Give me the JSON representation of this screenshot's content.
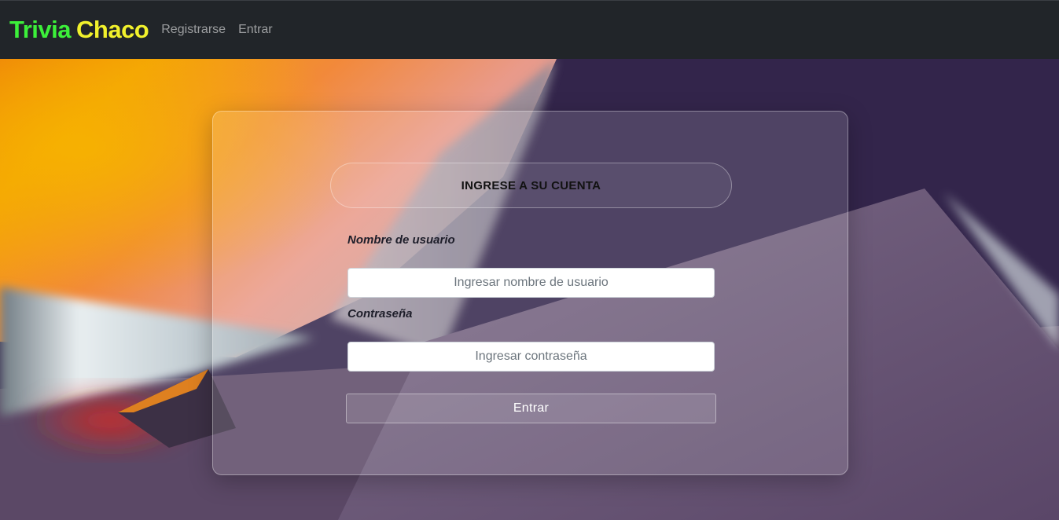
{
  "navbar": {
    "brand": {
      "part1": "Trivia",
      "part2": "Chaco",
      "part1_color": "#3cf03a",
      "part2_color": "#f1f12c"
    },
    "links": [
      {
        "label": "Registrarse"
      },
      {
        "label": "Entrar"
      }
    ],
    "background_color": "#212529"
  },
  "login_card": {
    "title": "INGRESE A SU CUENTA",
    "username": {
      "label": "Nombre de usuario",
      "placeholder": "Ingresar nombre de usuario",
      "value": ""
    },
    "password": {
      "label": "Contraseña",
      "placeholder": "Ingresar contraseña",
      "value": ""
    },
    "submit_label": "Entrar"
  },
  "colors": {
    "background_dark": "#33254b",
    "background_orange": "#f28a12",
    "background_mauve": "#6a5577"
  }
}
